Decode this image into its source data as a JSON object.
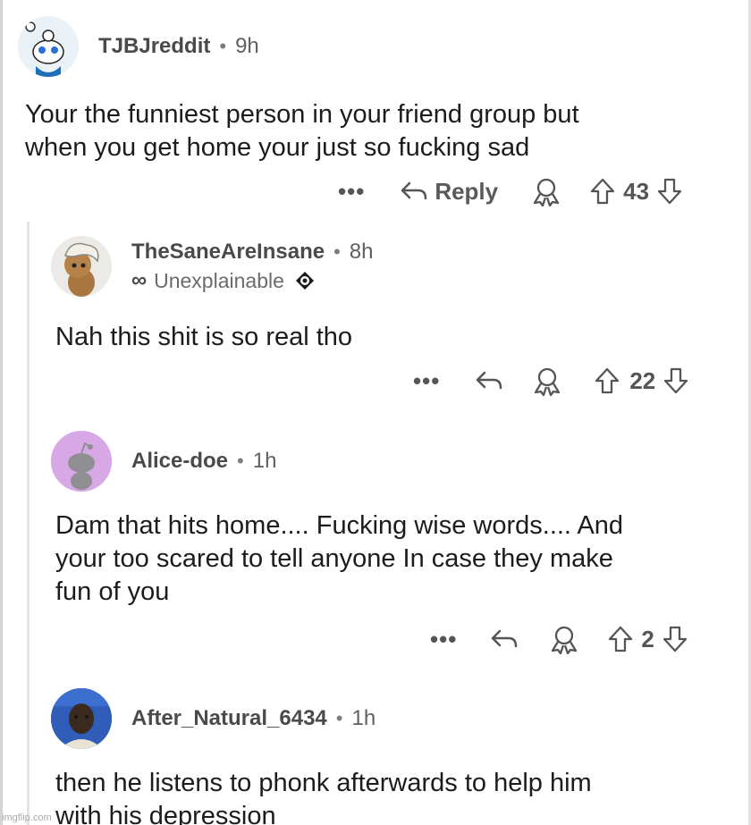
{
  "comments": [
    {
      "username": "TJBJreddit",
      "time": "9h",
      "text_lines": [
        "Your the funniest person in your friend group but",
        "when you get home your just so fucking sad"
      ],
      "reply_label": "Reply",
      "votes": "43",
      "avatar_icon": "snoo-avatar-icon",
      "avatar_bg": "#eaf2f8"
    },
    {
      "username": "TheSaneAreInsane",
      "time": "8h",
      "flair_symbol": "∞",
      "flair_text": "Unexplainable",
      "text_lines": [
        "Nah this shit is so real tho"
      ],
      "votes": "22",
      "avatar_icon": "curly-hair-avatar-icon",
      "avatar_bg": "#eceae6"
    },
    {
      "username": "Alice-doe",
      "time": "1h",
      "text_lines": [
        "Dam that hits home.... Fucking wise words.... And",
        "your too scared to tell anyone In case they make",
        "fun of you"
      ],
      "votes": "2",
      "avatar_icon": "default-snoo-avatar-icon",
      "avatar_bg": "#d8a8e6"
    },
    {
      "username": "After_Natural_6434",
      "time": "1h",
      "text_lines": [
        "then he listens to phonk afterwards to help him",
        "with his depression"
      ],
      "avatar_icon": "photo-avatar-icon",
      "avatar_bg": "#2f5db8"
    }
  ],
  "separator": "•",
  "more_label": "•••",
  "watermark": "imgflip.com",
  "colors": {
    "text": "#1c1c1d",
    "meta": "#4a4a4b",
    "icon": "#555555"
  }
}
